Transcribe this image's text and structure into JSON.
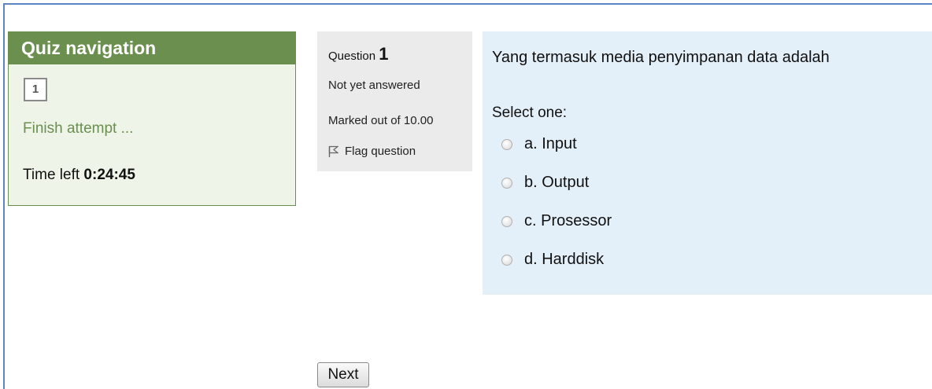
{
  "quiz_nav": {
    "title": "Quiz navigation",
    "question_button": "1",
    "finish_link": "Finish attempt ...",
    "time_label": "Time left",
    "time_value": "0:24:45"
  },
  "question_info": {
    "label": "Question",
    "number": "1",
    "state": "Not yet answered",
    "grade": "Marked out of 10.00",
    "flag": "Flag question",
    "flag_icon": "flag-icon"
  },
  "question": {
    "text": "Yang termasuk media penyimpanan data adalah",
    "prompt": "Select one:",
    "options": [
      {
        "label": "a. Input"
      },
      {
        "label": "b. Output"
      },
      {
        "label": "c. Prosessor"
      },
      {
        "label": "d. Harddisk"
      }
    ]
  },
  "next_button": "Next",
  "colors": {
    "nav_header": "#6b8f4e",
    "nav_bg": "#eef5e8",
    "info_bg": "#ebebeb",
    "content_bg": "#e3eff9",
    "frame_border": "#5b84c4"
  }
}
